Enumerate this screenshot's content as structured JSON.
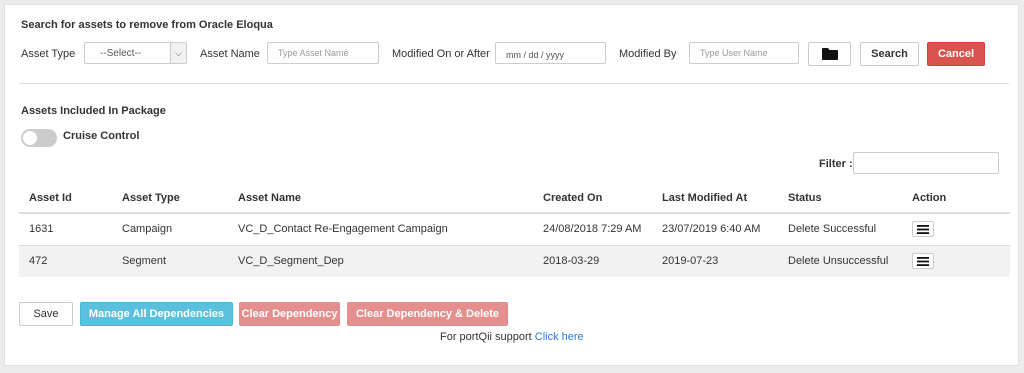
{
  "search": {
    "title": "Search for assets to remove from Oracle Eloqua",
    "asset_type_label": "Asset Type",
    "asset_type_value": "--Select--",
    "asset_name_label": "Asset Name",
    "asset_name_placeholder": "Type Asset Name",
    "modified_on_label": "Modified On or After",
    "modified_on_placeholder": "mm / dd / yyyy",
    "modified_by_label": "Modified By",
    "modified_by_placeholder": "Type User Name",
    "folder_icon": "folder-icon",
    "search_label": "Search",
    "cancel_label": "Cancel"
  },
  "package": {
    "title": "Assets Included In Package",
    "toggle_label": "Cruise Control",
    "toggle_on": false,
    "filter_label": "Filter :"
  },
  "table": {
    "columns": [
      "Asset Id",
      "Asset Type",
      "Asset Name",
      "Created On",
      "Last Modified At",
      "Status",
      "Action"
    ],
    "rows": [
      {
        "id": "1631",
        "type": "Campaign",
        "name": "VC_D_Contact Re-Engagement Campaign",
        "created": "24/08/2018 7:29 AM",
        "modified": "23/07/2019 6:40 AM",
        "status": "Delete Successful"
      },
      {
        "id": "472",
        "type": "Segment",
        "name": "VC_D_Segment_Dep",
        "created": "2018-03-29",
        "modified": "2019-07-23",
        "status": "Delete Unsuccessful"
      }
    ],
    "action_icon": "menu-icon"
  },
  "footer": {
    "save_label": "Save",
    "manage_label": "Manage All Dependencies",
    "clear_label": "Clear Dependency",
    "clear_delete_label": "Clear Dependency & Delete",
    "support_text": "For portQii support",
    "support_link": "Click here"
  },
  "colors": {
    "cancel": "#d9534f",
    "manage": "#5bc0de",
    "clear": "#e48f8d",
    "link": "#2a7bd1"
  }
}
